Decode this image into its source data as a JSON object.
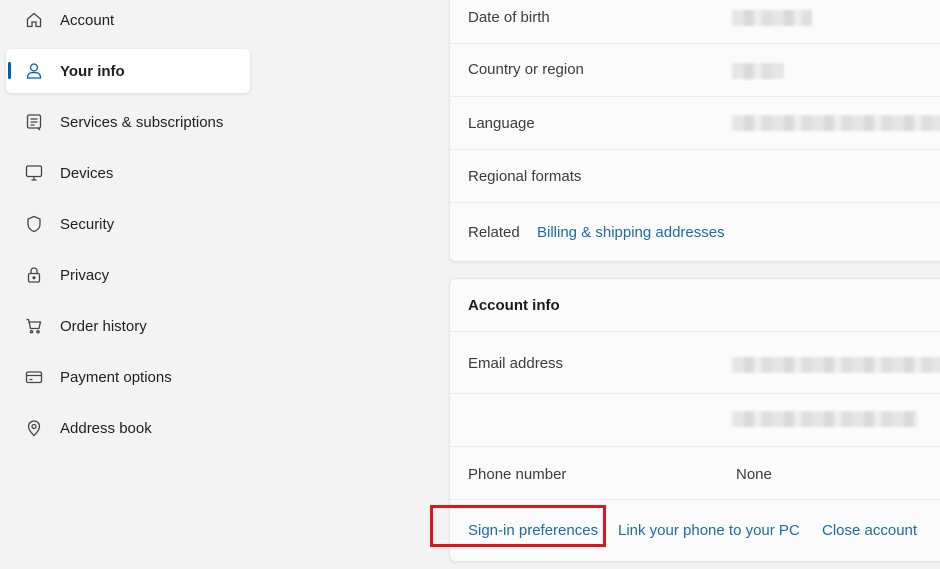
{
  "sidebar": {
    "items": [
      {
        "label": "Account",
        "icon": "home-icon"
      },
      {
        "label": "Your info",
        "icon": "person-icon",
        "active": true
      },
      {
        "label": "Services & subscriptions",
        "icon": "subscriptions-icon"
      },
      {
        "label": "Devices",
        "icon": "monitor-icon"
      },
      {
        "label": "Security",
        "icon": "shield-icon"
      },
      {
        "label": "Privacy",
        "icon": "lock-icon"
      },
      {
        "label": "Order history",
        "icon": "cart-icon"
      },
      {
        "label": "Payment options",
        "icon": "card-icon"
      },
      {
        "label": "Address book",
        "icon": "location-icon"
      }
    ]
  },
  "profile_info": {
    "date_of_birth_label": "Date of birth",
    "country_label": "Country or region",
    "language_label": "Language",
    "regional_formats_label": "Regional formats",
    "related_label": "Related",
    "billing_link": "Billing & shipping addresses"
  },
  "account_info": {
    "title": "Account info",
    "email_label": "Email address",
    "phone_label": "Phone number",
    "phone_value": "None",
    "signin_link": "Sign-in preferences",
    "link_phone_link": "Link your phone to your PC",
    "close_account_link": "Close account"
  },
  "colors": {
    "accent": "#005fb8",
    "link": "#1d6aa5",
    "highlight": "#e0141c"
  }
}
